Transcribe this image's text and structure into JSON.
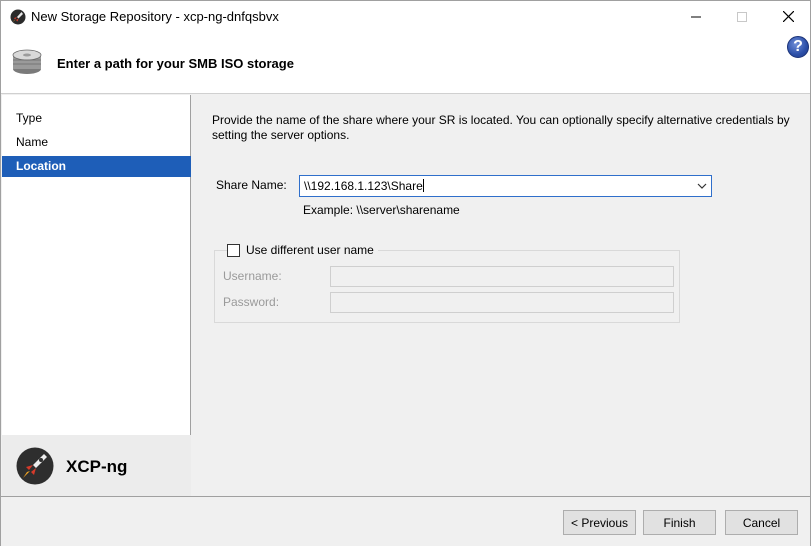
{
  "window": {
    "title": "New Storage Repository - xcp-ng-dnfqsbvx",
    "icons": {
      "app": "xcp-ng-rocket-icon",
      "minimize": "minimize-icon",
      "maximize": "maximize-icon",
      "close": "close-icon"
    }
  },
  "header": {
    "title": "Enter a path for your SMB ISO storage",
    "icon": "storage-disk-icon",
    "help": "?"
  },
  "nav": {
    "items": [
      {
        "label": "Type",
        "active": false
      },
      {
        "label": "Name",
        "active": false
      },
      {
        "label": "Location",
        "active": true
      }
    ],
    "logo_text": "XCP-ng",
    "active_color": "#1e5eb8"
  },
  "main": {
    "description": "Provide the name of the share where your SR is located. You can optionally specify alternative credentials by setting the server options.",
    "share_label": "Share Name:",
    "share_value": "\\\\192.168.1.123\\Share",
    "example": "Example: \\\\server\\sharename",
    "credentials": {
      "checkbox_label": "Use different user name",
      "checked": false,
      "username_label": "Username:",
      "password_label": "Password:",
      "username_value": "",
      "password_value": ""
    }
  },
  "footer": {
    "previous_label": "< Previous",
    "finish_label": "Finish",
    "cancel_label": "Cancel"
  }
}
